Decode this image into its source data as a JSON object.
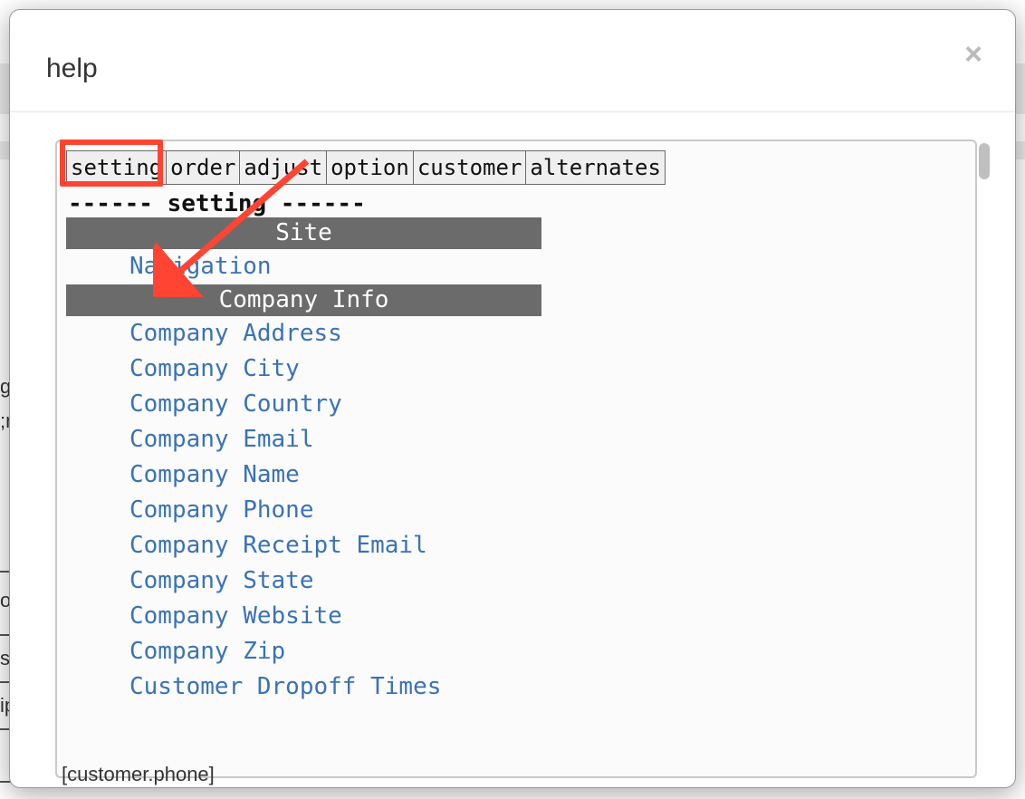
{
  "modal": {
    "title": "help",
    "close_glyph": "×"
  },
  "tabs": [
    "setting",
    "order",
    "adjust",
    "option",
    "customer",
    "alternates"
  ],
  "section_header": "------ setting ------",
  "blocks": [
    {
      "heading": "Site",
      "items": [
        "Navigation"
      ]
    },
    {
      "heading": "Company Info",
      "items": [
        "Company Address",
        "Company City",
        "Company Country",
        "Company Email",
        "Company Name",
        "Company Phone",
        "Company Receipt Email",
        "Company State",
        "Company Website",
        "Company Zip",
        "Customer Dropoff Times"
      ]
    }
  ],
  "background_fragments": {
    "c1": "ge",
    "c2": ";m",
    "c3": "on",
    "c4": "ss",
    "c5": "ip",
    "c6": "[customer.phone]"
  },
  "annotation": {
    "type": "arrow",
    "color": "#ff4433",
    "target": "tab-setting"
  }
}
